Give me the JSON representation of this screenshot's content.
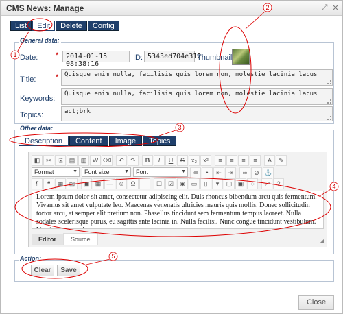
{
  "window": {
    "title": "CMS News: Manage",
    "restore_icon": "restore-icon",
    "close_icon": "close-icon"
  },
  "top_tabs": [
    "List",
    "Edit",
    "Delete",
    "Config"
  ],
  "general": {
    "legend": "General data:",
    "date_label": "Date:",
    "date_value": "2014-01-15 08:38:16",
    "id_label": "ID:",
    "id_value": "5343ed704e312",
    "thumbnail_label": "Thumbnail:",
    "title_label": "Title:",
    "title_value": "Quisque enim nulla, facilisis quis lorem non, molestie lacinia lacus",
    "keywords_label": "Keywords:",
    "keywords_value": "Quisque enim nulla, facilisis quis lorem non, molestie lacinia lacus",
    "topics_label": "Topics:",
    "topics_value": "act;brk",
    "required_mark": "*"
  },
  "other": {
    "legend": "Other data:",
    "tabs": [
      "Description",
      "Content",
      "Image",
      "Topics"
    ]
  },
  "editor": {
    "format_label": "Format",
    "fontsize_label": "Font size",
    "font_label": "Font",
    "text": "Lorem ipsum dolor sit amet, consectetur adipiscing elit. Duis rhoncus bibendum arcu quis fermentum. Vivamus sit amet vulputate leo. Maecenas venenatis ultricies mauris quis mollis. Donec sollicitudin tortor arcu, at semper elit pretium non. Phasellus tincidunt sem fermentum tempus laoreet. Nulla sodales scelerisque purus, eu sagittis ante lacinia in. Nulla facilisi. Nunc congue tincidunt vestibulum. Vestibulum ante ipsum.",
    "mode_editor": "Editor",
    "mode_source": "Source"
  },
  "action": {
    "legend": "Action:",
    "clear_label": "Clear",
    "save_label": "Save"
  },
  "footer": {
    "close_label": "Close"
  },
  "annotations": [
    "1",
    "2",
    "3",
    "4",
    "5"
  ]
}
